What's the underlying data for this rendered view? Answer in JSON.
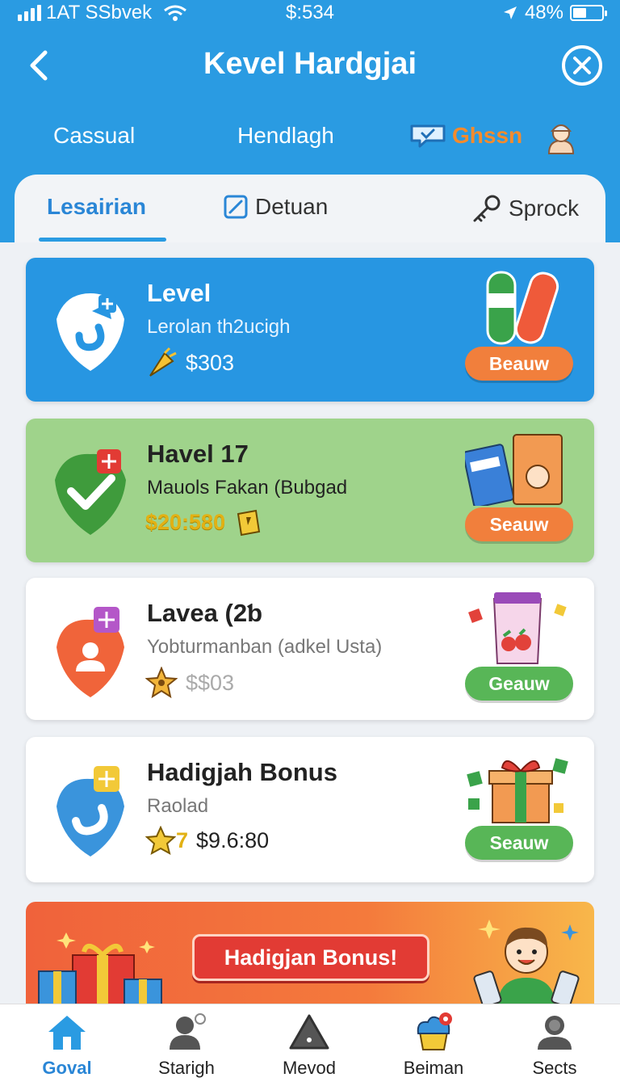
{
  "status_bar": {
    "carrier": "1AT SSbvek",
    "time": "$:534",
    "battery": "48%",
    "battery_level": 0.48
  },
  "header": {
    "title": "Kevel Hardgjai",
    "back_icon": "chevron-left-icon",
    "close_icon": "close-circle-icon"
  },
  "categories": [
    "Cassual",
    "Hendlagh",
    "Ghssn"
  ],
  "tabs": [
    {
      "label": "Lesairian",
      "active": true
    },
    {
      "label": "Detuan",
      "icon": "edit-square-icon"
    },
    {
      "label": "Sprock",
      "icon": "key-icon"
    }
  ],
  "cards": [
    {
      "title": "Level",
      "subtitle": "Lerolan th2ucigh",
      "reward": "$303",
      "button": "Beauw",
      "color": "#2796e2"
    },
    {
      "title": "Havel 17",
      "subtitle": "Mauols Fakan (Bubgad",
      "reward": "$20:580",
      "button": "Seauw",
      "color": "#9fd38b"
    },
    {
      "title": "Lavea (2ƅ",
      "subtitle": "Yobturmanban  (adkel Usta)",
      "reward": "$$03",
      "button": "Geauw",
      "color": "#ffffff"
    },
    {
      "title": "Hadigjah Bonus",
      "subtitle": "Raolad",
      "reward": "$9.6:80",
      "reward_prefix": "7",
      "button": "Seauw",
      "color": "#ffffff"
    }
  ],
  "promo": {
    "button": "Hadigjan Bonus!"
  },
  "bottom_nav": [
    {
      "label": "Goval",
      "icon": "home-icon",
      "active": true
    },
    {
      "label": "Starigh",
      "icon": "person-icon"
    },
    {
      "label": "Mevod",
      "icon": "triangle-icon"
    },
    {
      "label": "Beiman",
      "icon": "cupcake-icon"
    },
    {
      "label": "Sects",
      "icon": "profile-icon"
    }
  ],
  "colors": {
    "primary": "#2a9be2",
    "orange": "#f17f3c",
    "green": "#58b657"
  }
}
